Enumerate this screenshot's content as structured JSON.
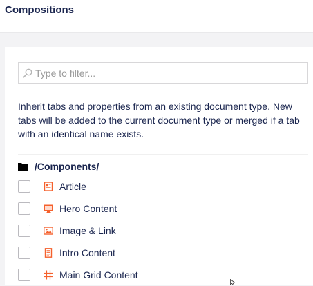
{
  "header": {
    "title": "Compositions"
  },
  "filter": {
    "placeholder": "Type to filter...",
    "value": "",
    "icon": "search-icon"
  },
  "description": "Inherit tabs and properties from an existing document type. New tabs will be added to the current document type or merged if a tab with an identical name exists.",
  "group": {
    "label": "/Components/",
    "icon": "folder-icon"
  },
  "items": [
    {
      "label": "Article",
      "icon": "article-icon",
      "checked": false
    },
    {
      "label": "Hero Content",
      "icon": "monitor-icon",
      "checked": false
    },
    {
      "label": "Image & Link",
      "icon": "picture-icon",
      "checked": false
    },
    {
      "label": "Intro Content",
      "icon": "document-icon",
      "checked": false
    },
    {
      "label": "Main Grid Content",
      "icon": "grid-icon",
      "checked": false
    }
  ],
  "colors": {
    "icon_accent": "#f5612d",
    "text": "#1b264f",
    "background": "#f3f3f5"
  }
}
